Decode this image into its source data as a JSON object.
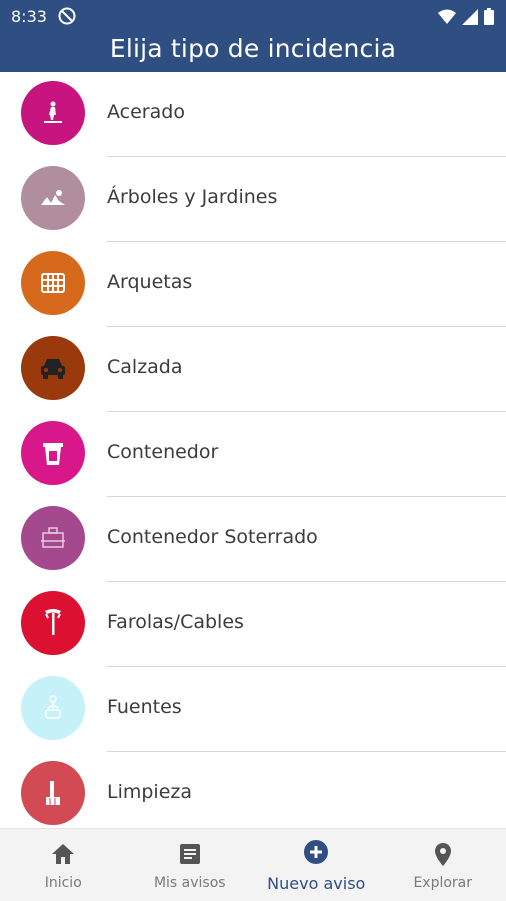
{
  "status_bar": {
    "time": "8:33"
  },
  "header": {
    "title": "Elija tipo de incidencia"
  },
  "items": [
    {
      "label": "Acerado",
      "color": "#c8147e",
      "icon": "pedestrian-icon"
    },
    {
      "label": "Árboles y Jardines",
      "color": "#b08e9e",
      "icon": "garden-icon"
    },
    {
      "label": "Arquetas",
      "color": "#d6691c",
      "icon": "grate-icon"
    },
    {
      "label": "Calzada",
      "color": "#9a3a0c",
      "icon": "car-icon"
    },
    {
      "label": "Contenedor",
      "color": "#d8188a",
      "icon": "bin-icon"
    },
    {
      "label": "Contenedor Soterrado",
      "color": "#a4498e",
      "icon": "underground-bin-icon"
    },
    {
      "label": "Farolas/Cables",
      "color": "#dc1030",
      "icon": "streetlight-icon"
    },
    {
      "label": "Fuentes",
      "color": "#c4f2f8",
      "icon": "fountain-icon"
    },
    {
      "label": "Limpieza",
      "color": "#d14a54",
      "icon": "broom-icon"
    }
  ],
  "nav": [
    {
      "label": "Inicio",
      "icon": "home-icon"
    },
    {
      "label": "Mis avisos",
      "icon": "document-icon"
    },
    {
      "label": "Nuevo aviso",
      "icon": "add-circle-icon"
    },
    {
      "label": "Explorar",
      "icon": "location-pin-icon"
    }
  ]
}
